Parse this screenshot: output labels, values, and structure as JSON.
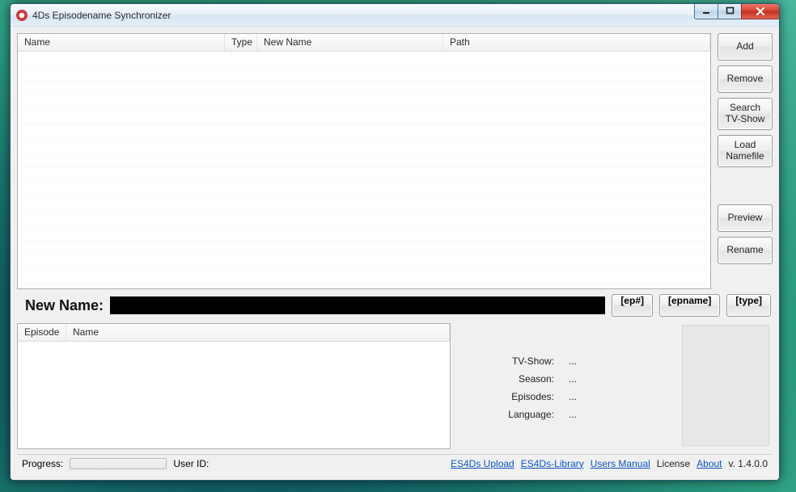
{
  "window": {
    "title": "4Ds Episodename Synchronizer"
  },
  "grid": {
    "columns": {
      "name": "Name",
      "type": "Type",
      "newname": "New Name",
      "path": "Path"
    }
  },
  "side": {
    "add": "Add",
    "remove": "Remove",
    "search": "Search\nTV-Show",
    "load": "Load\nNamefile",
    "preview": "Preview",
    "rename": "Rename"
  },
  "newname": {
    "label": "New Name:",
    "value": "",
    "token_ep": "[ep#]",
    "token_epname": "[epname]",
    "token_type": "[type]"
  },
  "episodes": {
    "columns": {
      "episode": "Episode",
      "name": "Name"
    }
  },
  "info": {
    "tvshow_label": "TV-Show:",
    "tvshow_value": "...",
    "season_label": "Season:",
    "season_value": "...",
    "episodes_label": "Episodes:",
    "episodes_value": "...",
    "language_label": "Language:",
    "language_value": "..."
  },
  "status": {
    "progress_label": "Progress:",
    "userid_label": "User ID:",
    "links": {
      "upload": "ES4Ds Upload",
      "library": "ES4Ds-Library",
      "manual": "Users Manual",
      "license": "License",
      "about": "About"
    },
    "version": "v. 1.4.0.0"
  }
}
